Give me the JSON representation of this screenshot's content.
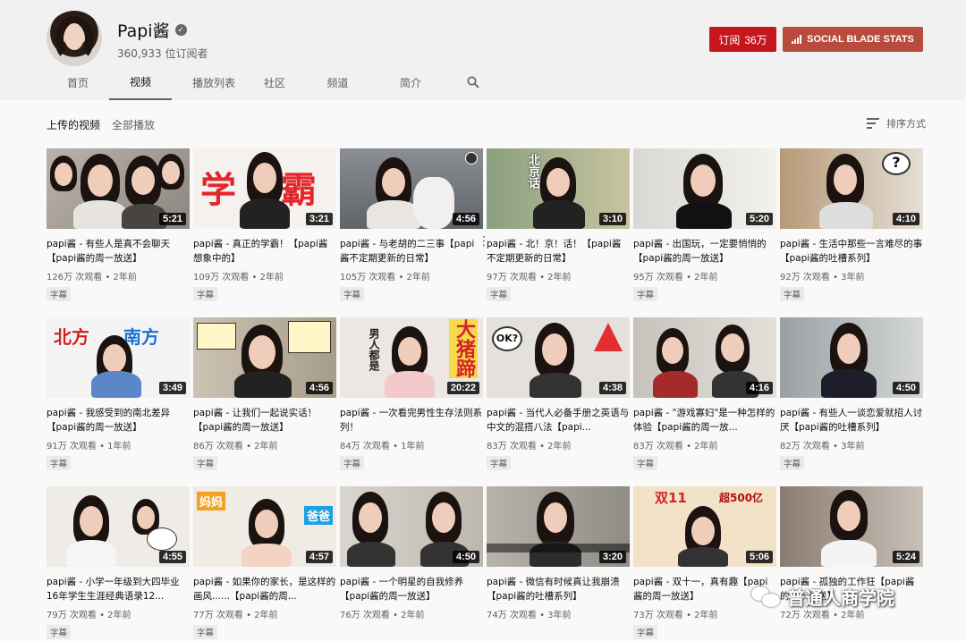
{
  "channel": {
    "name": "Papi酱",
    "subscribers": "360,933 位订阅者",
    "subscribe_label": "订阅",
    "subscribe_count": "36万",
    "socialblade_label": "SOCIAL BLADE STATS"
  },
  "tabs": [
    {
      "label": "首页"
    },
    {
      "label": "视频"
    },
    {
      "label": "播放列表"
    },
    {
      "label": "社区"
    },
    {
      "label": "频道"
    },
    {
      "label": "简介"
    }
  ],
  "section": {
    "title": "上传的视频",
    "play_all": "全部播放",
    "sort_label": "排序方式"
  },
  "videos": [
    {
      "title": "papi酱 - 有些人是真不会聊天【papi酱的周一放送】",
      "views": "126万 次观看",
      "age": "2年前",
      "duration": "5:21",
      "badge": "字幕"
    },
    {
      "title": "papi酱 - 真正的学霸！【papi酱想象中的】",
      "views": "109万 次观看",
      "age": "2年前",
      "duration": "3:21",
      "badge": "字幕",
      "thumb_text": "学  霸"
    },
    {
      "title": "papi酱 - 与老胡的二三事【papi酱不定期更新的日常】",
      "views": "105万 次观看",
      "age": "2年前",
      "duration": "4:56",
      "badge": "字幕"
    },
    {
      "title": "papi酱 - 北！京！话！【papi酱不定期更新的日常】",
      "views": "97万 次观看",
      "age": "2年前",
      "duration": "3:10",
      "badge": "字幕",
      "thumb_text": "北京话"
    },
    {
      "title": "papi酱 - 出国玩，一定要悄悄的【papi酱的周一放送】",
      "views": "95万 次观看",
      "age": "2年前",
      "duration": "5:20",
      "badge": "字幕"
    },
    {
      "title": "papi酱 - 生活中那些一言难尽的事【papi酱的吐槽系列】",
      "views": "92万 次观看",
      "age": "3年前",
      "duration": "4:10",
      "badge": "字幕"
    },
    {
      "title": "papi酱 - 我感受到的南北差异【papi酱的周一放送】",
      "views": "91万 次观看",
      "age": "1年前",
      "duration": "3:49",
      "badge": "字幕",
      "thumb_text_a": "北方",
      "thumb_text_b": "南方"
    },
    {
      "title": "papi酱 - 让我们一起说实话！【papi酱的周一放送】",
      "views": "86万 次观看",
      "age": "2年前",
      "duration": "4:56",
      "badge": "字幕"
    },
    {
      "title": "papi酱 - 一次看完男性生存法则系列！",
      "views": "84万 次观看",
      "age": "1年前",
      "duration": "20:22",
      "badge": "字幕",
      "thumb_text_a": "男人都是",
      "thumb_text_b": "大猪蹄"
    },
    {
      "title": "papi酱 - 当代人必备手册之英语与中文的混搭八法【papi...",
      "views": "83万 次观看",
      "age": "2年前",
      "duration": "4:38",
      "badge": "字幕",
      "thumb_text": "OK?"
    },
    {
      "title": "papi酱 - \"游戏寡妇\"是一种怎样的体验【papi酱的周一放...",
      "views": "83万 次观看",
      "age": "2年前",
      "duration": "4:16",
      "badge": "字幕"
    },
    {
      "title": "papi酱 - 有些人一谈恋爱就招人讨厌【papi酱的吐槽系列】",
      "views": "82万 次观看",
      "age": "3年前",
      "duration": "4:50",
      "badge": "字幕"
    },
    {
      "title": "papi酱 - 小学一年级到大四毕业 16年学生生涯经典语录12...",
      "views": "79万 次观看",
      "age": "2年前",
      "duration": "4:55",
      "badge": "字幕"
    },
    {
      "title": "papi酱 - 如果你的家长，是这样的画风......【papi酱的周...",
      "views": "77万 次观看",
      "age": "2年前",
      "duration": "4:57",
      "badge": "字幕",
      "thumb_text_a": "妈妈",
      "thumb_text_b": "爸爸"
    },
    {
      "title": "papi酱 - 一个明星的自我修养【papi酱的周一放送】",
      "views": "76万 次观看",
      "age": "2年前",
      "duration": "4:50",
      "badge": ""
    },
    {
      "title": "papi酱 - 微信有时候真让我崩溃【papi酱的吐槽系列】",
      "views": "74万 次观看",
      "age": "3年前",
      "duration": "3:20",
      "badge": ""
    },
    {
      "title": "papi酱 - 双十一，真有趣【papi酱的周一放送】",
      "views": "73万 次观看",
      "age": "2年前",
      "duration": "5:06",
      "badge": "字幕",
      "thumb_text_a": "双11",
      "thumb_text_b": "超500亿"
    },
    {
      "title": "papi酱 - 孤独的工作狂【papi酱的周一放送】",
      "views": "72万 次观看",
      "age": "2年前",
      "duration": "5:24",
      "badge": ""
    }
  ],
  "watermark": {
    "text": "普通人商学院",
    "icon": "wechat-icon"
  },
  "colors": {
    "subscribe": "#c4161c",
    "socialblade": "#b94a3e",
    "header_bg": "#f1f1f1",
    "page_bg": "#f9f9f9"
  }
}
